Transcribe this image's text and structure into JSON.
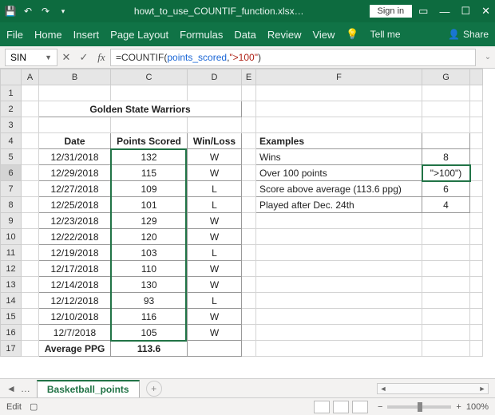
{
  "titlebar": {
    "filename": "howt_to_use_COUNTIF_function.xlsx…",
    "signin": "Sign in"
  },
  "ribbon": {
    "tabs": [
      "File",
      "Home",
      "Insert",
      "Page Layout",
      "Formulas",
      "Data",
      "Review",
      "View"
    ],
    "tellme": "Tell me",
    "share": "Share"
  },
  "fbar": {
    "namebox": "SIN",
    "cancel": "✕",
    "enter": "✓",
    "formula_prefix": "=COUNTIF(",
    "formula_range": "points_scored",
    "formula_mid": ",",
    "formula_text": "\">100\"",
    "formula_suffix": ")"
  },
  "cols": [
    "A",
    "B",
    "C",
    "D",
    "E",
    "F",
    "G"
  ],
  "rows": [
    "1",
    "2",
    "3",
    "4",
    "5",
    "6",
    "7",
    "8",
    "9",
    "10",
    "11",
    "12",
    "13",
    "14",
    "15",
    "16",
    "17"
  ],
  "title_merged": "Golden State Warriors",
  "headers": {
    "date": "Date",
    "points": "Points Scored",
    "winloss": "Win/Loss"
  },
  "data_rows": [
    {
      "d": "12/31/2018",
      "p": "132",
      "w": "W"
    },
    {
      "d": "12/29/2018",
      "p": "115",
      "w": "W"
    },
    {
      "d": "12/27/2018",
      "p": "109",
      "w": "L"
    },
    {
      "d": "12/25/2018",
      "p": "101",
      "w": "L"
    },
    {
      "d": "12/23/2018",
      "p": "129",
      "w": "W"
    },
    {
      "d": "12/22/2018",
      "p": "120",
      "w": "W"
    },
    {
      "d": "12/19/2018",
      "p": "103",
      "w": "L"
    },
    {
      "d": "12/17/2018",
      "p": "110",
      "w": "W"
    },
    {
      "d": "12/14/2018",
      "p": "130",
      "w": "W"
    },
    {
      "d": "12/12/2018",
      "p": "93",
      "w": "L"
    },
    {
      "d": "12/10/2018",
      "p": "116",
      "w": "W"
    },
    {
      "d": "12/7/2018",
      "p": "105",
      "w": "W"
    }
  ],
  "avg": {
    "label": "Average PPG",
    "value": "113.6"
  },
  "examples": {
    "header": "Examples",
    "rows": [
      {
        "label": "Wins",
        "value": "8"
      },
      {
        "label": "Over 100 points",
        "value": "\">100\")"
      },
      {
        "label": "Score above average (113.6 ppg)",
        "value": "6"
      },
      {
        "label": "Played after Dec. 24th",
        "value": "4"
      }
    ]
  },
  "sheettab": "Basketball_points",
  "status": {
    "mode": "Edit",
    "zoom": "100%"
  }
}
